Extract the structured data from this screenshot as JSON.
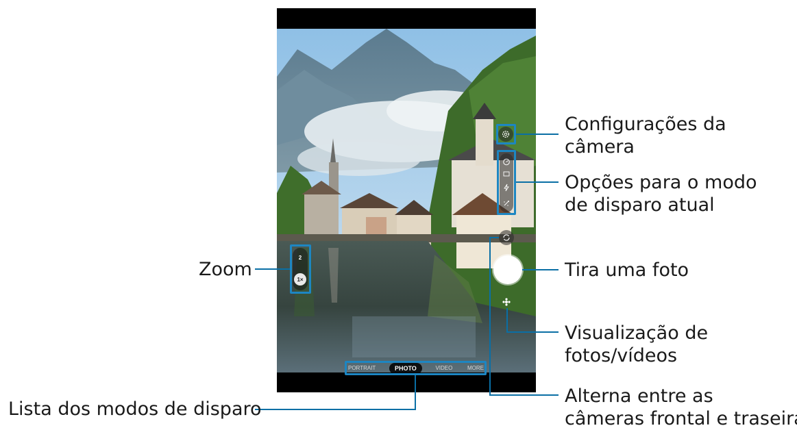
{
  "callouts": {
    "zoom": "Zoom",
    "camera_settings_line1": "Configurações da",
    "camera_settings_line2": "câmera",
    "mode_options_line1": "Opções para o modo",
    "mode_options_line2": "de disparo atual",
    "take_photo": "Tira uma foto",
    "preview_line1": "Visualização de",
    "preview_line2": "fotos/vídeos",
    "switch_line1": "Alterna entre as",
    "switch_line2": "câmeras frontal e traseira",
    "modes_list": "Lista dos modos de disparo"
  },
  "camera": {
    "zoom_options": [
      "2",
      "1×"
    ],
    "shooting_modes": [
      "PORTRAIT",
      "PHOTO",
      "VIDEO",
      "MORE"
    ],
    "active_mode": "PHOTO"
  },
  "icons": {
    "settings": "gear-icon",
    "timer": "timer-icon",
    "ratio": "aspect-ratio-icon",
    "flash": "flash-icon",
    "filter": "filter-icon",
    "switch": "switch-camera-icon",
    "preview": "gallery-preview-icon"
  },
  "colors": {
    "callout_line": "#0a6fa5",
    "highlight_frame": "#1d86c2"
  }
}
